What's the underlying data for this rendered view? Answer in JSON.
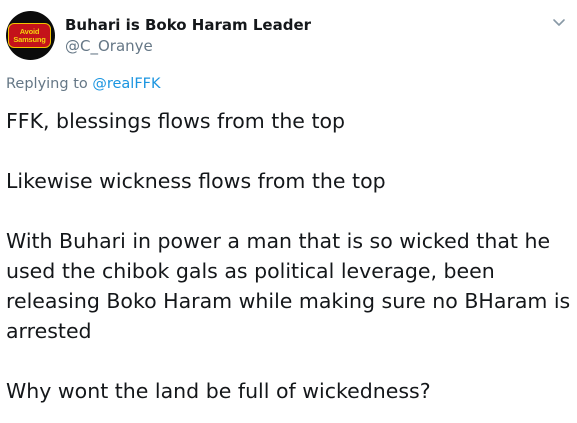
{
  "author": {
    "display_name": "Buhari is Boko Haram Leader",
    "handle": "@C_Oranye",
    "avatar_text": [
      "Avoid",
      "Samsung"
    ]
  },
  "reply": {
    "prefix": "Replying to ",
    "to": "@realFFK"
  },
  "body": {
    "paragraphs": [
      "FFK, blessings flows from the top",
      "Likewise wickness flows from the top",
      "With Buhari in power a man that is so wicked that he used the chibok gals as political leverage, been releasing Boko Haram while making sure no BHaram is arrested",
      "Why wont the land be full of wickedness?"
    ]
  },
  "icons": {
    "more_menu": "chevron-down-icon"
  },
  "colors": {
    "text_primary": "#14171a",
    "text_secondary": "#657786",
    "link": "#1b95e0",
    "avatar_bg": "#0b0b0b",
    "badge_red": "#c4121a",
    "badge_yellow": "#f4d20f"
  }
}
